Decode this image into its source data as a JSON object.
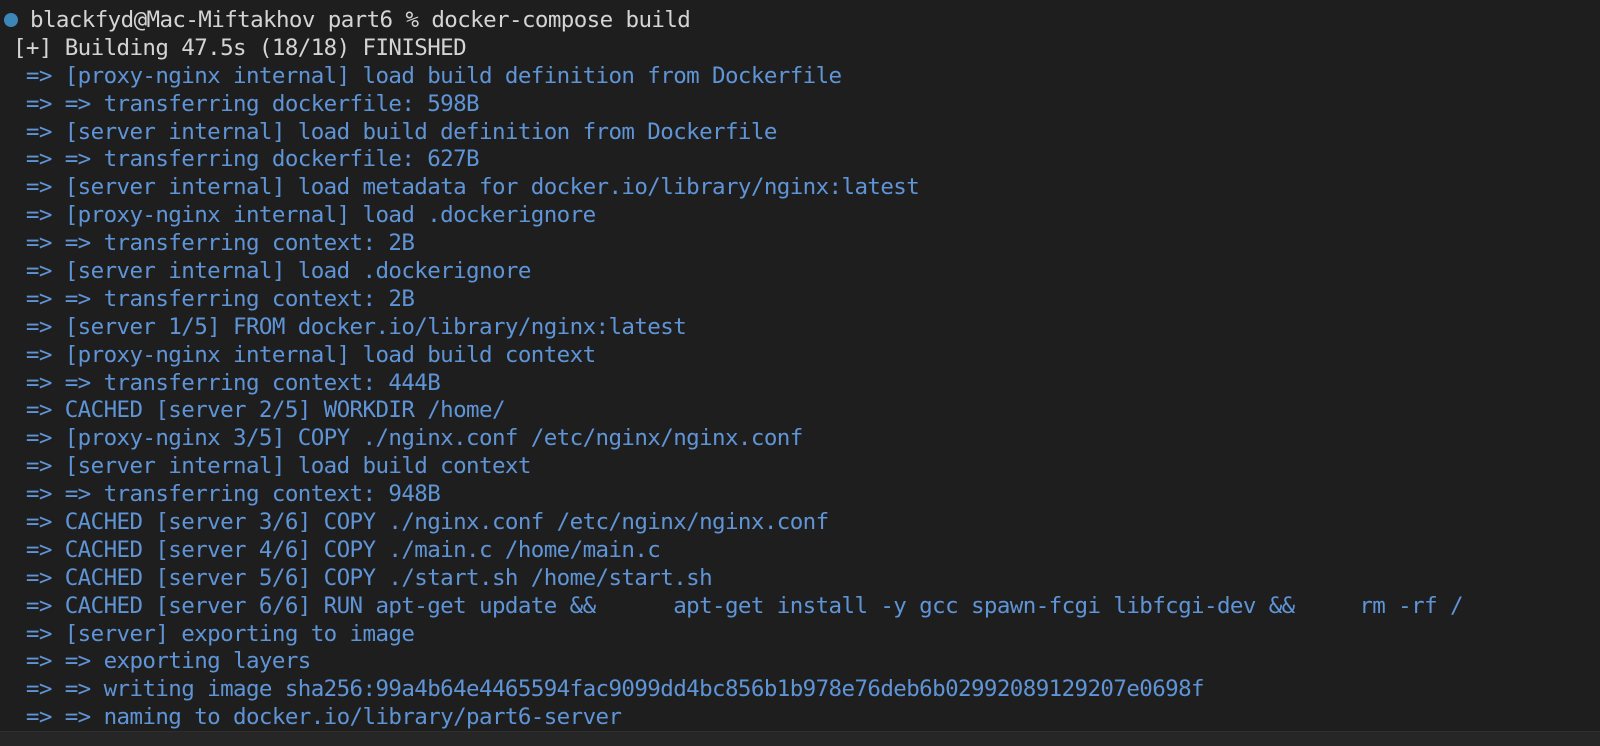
{
  "terminal": {
    "prompt": {
      "text": "blackfyd@Mac-Miftakhov part6 % docker-compose build",
      "status_dot_color": "#3c86b8"
    },
    "status_line": " [+] Building 47.5s (18/18) FINISHED",
    "output_color": "#5f94d6",
    "lines": [
      "  => [proxy-nginx internal] load build definition from Dockerfile",
      "  => => transferring dockerfile: 598B",
      "  => [server internal] load build definition from Dockerfile",
      "  => => transferring dockerfile: 627B",
      "  => [server internal] load metadata for docker.io/library/nginx:latest",
      "  => [proxy-nginx internal] load .dockerignore",
      "  => => transferring context: 2B",
      "  => [server internal] load .dockerignore",
      "  => => transferring context: 2B",
      "  => [server 1/5] FROM docker.io/library/nginx:latest",
      "  => [proxy-nginx internal] load build context",
      "  => => transferring context: 444B",
      "  => CACHED [server 2/5] WORKDIR /home/",
      "  => [proxy-nginx 3/5] COPY ./nginx.conf /etc/nginx/nginx.conf",
      "  => [server internal] load build context",
      "  => => transferring context: 948B",
      "  => CACHED [server 3/6] COPY ./nginx.conf /etc/nginx/nginx.conf",
      "  => CACHED [server 4/6] COPY ./main.c /home/main.c",
      "  => CACHED [server 5/6] COPY ./start.sh /home/start.sh",
      "  => CACHED [server 6/6] RUN apt-get update &&      apt-get install -y gcc spawn-fcgi libfcgi-dev &&     rm -rf /",
      "  => [server] exporting to image",
      "  => => exporting layers",
      "  => => writing image sha256:99a4b64e4465594fac9099dd4bc856b1b978e76deb6b02992089129207e0698f",
      "  => => naming to docker.io/library/part6-server"
    ]
  }
}
